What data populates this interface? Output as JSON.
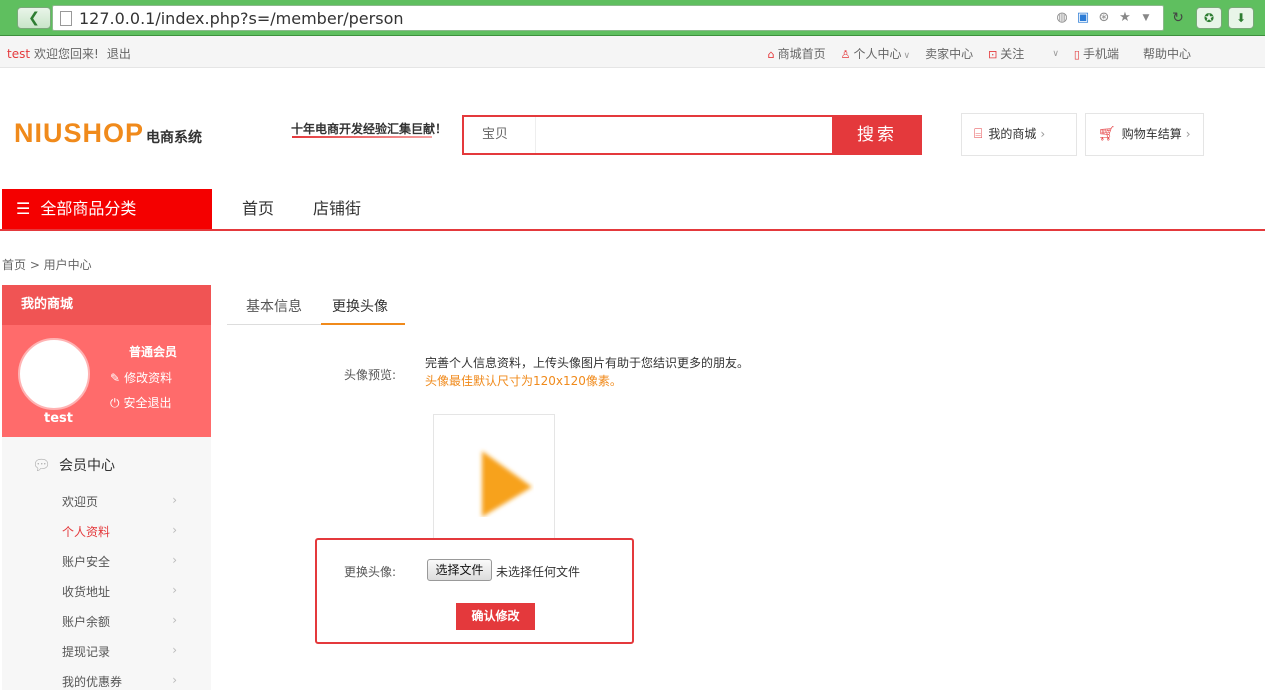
{
  "browser": {
    "url": "127.0.0.1/index.php?s=/member/person",
    "back_icon": "back-arrow-icon",
    "reload_icon": "reload-icon"
  },
  "topbar": {
    "username": "test",
    "welcome": "欢迎您回来!",
    "logout": "退出",
    "links": [
      {
        "label": "商城首页",
        "icon": "home-icon"
      },
      {
        "label": "个人中心",
        "icon": "user-icon"
      },
      {
        "label": "卖家中心",
        "icon": ""
      },
      {
        "label": "关注",
        "icon": "follow-icon"
      },
      {
        "label": "手机端",
        "icon": "phone-icon"
      },
      {
        "label": "帮助中心",
        "icon": ""
      }
    ]
  },
  "header": {
    "logo_main": "NIUSHOP",
    "logo_sub": "电商系统",
    "slogan": "十年电商开发经验汇集巨献！",
    "search_type": "宝贝",
    "search_placeholder": "",
    "search_button": "搜索",
    "my_shop": "我的商城",
    "cart": "购物车结算"
  },
  "nav": {
    "all_categories": "全部商品分类",
    "items": [
      "首页",
      "店铺街"
    ]
  },
  "breadcrumb": "首页 > 用户中心",
  "sidebar": {
    "title": "我的商城",
    "username": "test",
    "level": "普通会员",
    "edit_profile": "修改资料",
    "logout": "安全退出",
    "menu_title": "会员中心",
    "menu_items": [
      "欢迎页",
      "个人资料",
      "账户安全",
      "收货地址",
      "账户余额",
      "提现记录",
      "我的优惠券"
    ],
    "active_item": "个人资料"
  },
  "main": {
    "tabs": [
      "基本信息",
      "更换头像"
    ],
    "active_tab": "更换头像",
    "preview_label": "头像预览:",
    "info_line1": "完善个人信息资料，上传头像图片有助于您结识更多的朋友。",
    "info_line2": "头像最佳默认尺寸为120x120像素。",
    "change_label": "更换头像:",
    "file_button": "选择文件",
    "file_status": "未选择任何文件",
    "confirm_button": "确认修改"
  },
  "colors": {
    "accent": "#e4393c",
    "brand_orange": "#f08a1b",
    "browser_green": "#5fbf5f"
  }
}
